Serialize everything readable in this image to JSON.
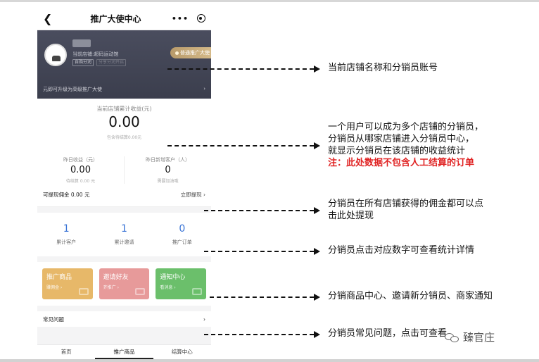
{
  "nav": {
    "back_icon": "chevron-left-icon",
    "title": "推广大使中心",
    "more": "•••",
    "close_icon": "target-icon"
  },
  "header": {
    "store_line": "当前店铺:超码运动馆",
    "tags": [
      "自购分润",
      "分享分润开启"
    ],
    "level_badge": "普通推广大使",
    "upgrade_text": "元即可升级为高级推广大使",
    "upgrade_arrow": "›"
  },
  "earnings": {
    "label": "当前店铺累计收益(元)",
    "total": "0.00",
    "pending": "包含待结算0.00元",
    "cols": [
      {
        "label": "昨日收益（元）",
        "value": "0.00",
        "note": "待结算 0.00 元"
      },
      {
        "label": "昨日新增客户（人）",
        "value": "0",
        "note": "需要加油哦"
      }
    ],
    "withdraw_label": "可提现佣金 0.00 元",
    "withdraw_action": "立即提现",
    "withdraw_arrow": "›"
  },
  "stats": [
    {
      "value": "1",
      "label": "累计客户"
    },
    {
      "value": "1",
      "label": "累计邀请"
    },
    {
      "value": "0",
      "label": "推广订单"
    }
  ],
  "cards": [
    {
      "title": "推广商品",
      "sub": "赚佣金 ›",
      "color": "#e7b869"
    },
    {
      "title": "邀请好友",
      "sub": "齐推广 ›",
      "color": "#e79a9a"
    },
    {
      "title": "通知中心",
      "sub": "看消息 ›",
      "color": "#6bbf6b"
    }
  ],
  "faq": {
    "label": "常见问题",
    "arrow": "›"
  },
  "tabs": [
    "首页",
    "推广商品",
    "结算中心"
  ],
  "active_tab": "推广商品",
  "annotations": {
    "a1": "当前店铺名称和分销员账号",
    "a2_l1": "一个用户可以成为多个店铺的分销员，",
    "a2_l2": "分销员从哪家店铺进入分销员中心，",
    "a2_l3": "就显示分销员在该店铺的收益统计",
    "a2_l4": "注：此处数据不包含人工结算的订单",
    "a3_l1": "分销员在所有店铺获得的佣金都可以点",
    "a3_l2": "击此处提现",
    "a4": "分销员点击对应数字可查看统计详情",
    "a5": "分销商品中心、邀请新分销员、商家通知",
    "a6": "分销员常见问题，点击可查看"
  },
  "watermark": "臻官庄",
  "colors": {
    "note_red": "#e02424",
    "stat_blue": "#3a74d6",
    "header_bg": "#40434f"
  }
}
